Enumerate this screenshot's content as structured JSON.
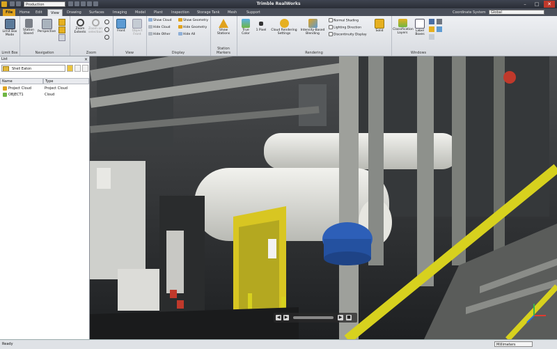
{
  "titlebar": {
    "title": "Trimble RealWorks",
    "project_combo": "Production",
    "minimize": "–",
    "maximize": "□",
    "close": "✕"
  },
  "tabs": [
    "File",
    "Home",
    "Edit",
    "View",
    "Drawing",
    "Surfaces",
    "Imaging",
    "Model",
    "Plant",
    "Inspection",
    "Storage Tank",
    "Mesh",
    "Support"
  ],
  "active_tab": "View",
  "coordinate_system": {
    "label": "Coordinate System",
    "value": "Global"
  },
  "ribbon": {
    "groups": {
      "limit_box": "Limit Box",
      "navigation": "Navigation",
      "zoom": "Zoom",
      "view": "View",
      "display": "Display",
      "station_markers": "Station Markers",
      "rendering": "Rendering",
      "windows": "Windows"
    },
    "buttons": {
      "limit_box_mode": "Limit Box Mode",
      "station_based": "Station Based",
      "perspective": "Perspective",
      "zoom_extents": "Zoom Extents",
      "zoom_on_selection": "Zoom on selection",
      "front": "Front",
      "object_front": "Object Front",
      "show_stations": "Show Stations",
      "true_color": "True Color",
      "one_pixel": "1 Pixel",
      "cloud_rendering_settings": "Cloud Rendering Settings",
      "intensity_based_blending": "Intensity-Based Blending",
      "solid": "Solid",
      "classification_layers": "Classification Layers",
      "label_boxes": "Label Boxes"
    },
    "display_items": [
      "Show Cloud",
      "Hide Cloud",
      "Hide Other",
      "Show Geometry",
      "Hide Geometry",
      "Hide All"
    ],
    "rendering_items": [
      "Normal Shading",
      "Lighting Direction",
      "Discontinuity Display"
    ]
  },
  "panel": {
    "title": "List",
    "filter_value": "Shell Eaton",
    "columns": [
      "Name",
      "Type"
    ],
    "rows": [
      {
        "name": "Project Cloud",
        "type": "Project Cloud"
      },
      {
        "name": "OBJECT1",
        "type": "Cloud"
      }
    ]
  },
  "viewport": {
    "axis_x": "x",
    "axis_y": "y",
    "axis_z": "z"
  },
  "statusbar": {
    "status": "Ready",
    "units": "Millimeters"
  },
  "colors": {
    "accent": "#e0a21d",
    "titlebar": "#2f333b",
    "ribbon": "#e4e7eb"
  }
}
